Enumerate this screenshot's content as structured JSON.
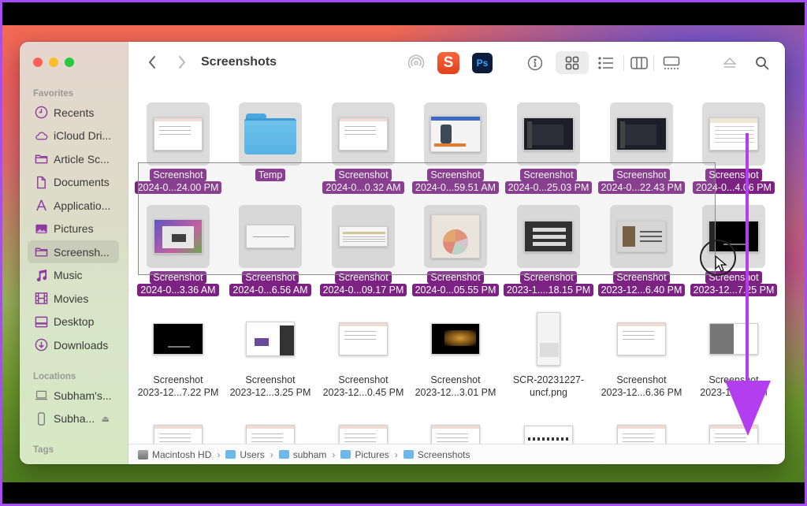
{
  "window": {
    "title": "Screenshots",
    "traffic_lights": [
      "close",
      "minimize",
      "maximize"
    ]
  },
  "sidebar": {
    "favorites_label": "Favorites",
    "favorites": [
      {
        "label": "Recents",
        "icon": "clock-icon"
      },
      {
        "label": "iCloud Dri...",
        "icon": "cloud-icon"
      },
      {
        "label": "Article Sc...",
        "icon": "folder-icon"
      },
      {
        "label": "Documents",
        "icon": "document-icon"
      },
      {
        "label": "Applicatio...",
        "icon": "applications-icon"
      },
      {
        "label": "Pictures",
        "icon": "pictures-icon"
      },
      {
        "label": "Screensh...",
        "icon": "folder-icon",
        "active": true
      },
      {
        "label": "Music",
        "icon": "music-icon"
      },
      {
        "label": "Movies",
        "icon": "film-icon"
      },
      {
        "label": "Desktop",
        "icon": "desktop-icon"
      },
      {
        "label": "Downloads",
        "icon": "download-icon"
      }
    ],
    "locations_label": "Locations",
    "locations": [
      {
        "label": "Subham's...",
        "icon": "laptop-icon"
      },
      {
        "label": "Subha...",
        "icon": "phone-icon",
        "eject": true
      }
    ],
    "tags_label": "Tags"
  },
  "toolbar": {
    "back": "back-icon",
    "forward": "forward-icon",
    "airdrop": "airdrop-icon",
    "apps": [
      "S",
      "Ps"
    ],
    "view_modes": [
      "icon",
      "list",
      "column",
      "gallery"
    ],
    "active_view": "icon"
  },
  "files": [
    {
      "line1": "Screenshot",
      "line2": "2024-0...24.00 PM",
      "selected": true,
      "kind": "light"
    },
    {
      "line1": "Temp",
      "line2": "",
      "selected": true,
      "kind": "folder"
    },
    {
      "line1": "Screenshot",
      "line2": "2024-0...0.32 AM",
      "selected": true,
      "kind": "light"
    },
    {
      "line1": "Screenshot",
      "line2": "2024-0...59.51 AM",
      "selected": true,
      "kind": "product"
    },
    {
      "line1": "Screenshot",
      "line2": "2024-0...25.03 PM",
      "selected": true,
      "kind": "dark"
    },
    {
      "line1": "Screenshot",
      "line2": "2024-0...22.43 PM",
      "selected": true,
      "kind": "dark"
    },
    {
      "line1": "Screenshot",
      "line2": "2024-0...4.06 PM",
      "selected": true,
      "kind": "sheet"
    },
    {
      "line1": "Screenshot",
      "line2": "2024-0...3.36 AM",
      "selected": true,
      "kind": "desktop"
    },
    {
      "line1": "Screenshot",
      "line2": "2024-0...6.56 AM",
      "selected": true,
      "kind": "diagram"
    },
    {
      "line1": "Screenshot",
      "line2": "2024-0...09.17 PM",
      "selected": true,
      "kind": "text"
    },
    {
      "line1": "Screenshot",
      "line2": "2024-0...05.55 PM",
      "selected": true,
      "kind": "pie"
    },
    {
      "line1": "Screenshot",
      "line2": "2023-1....18.15 PM",
      "selected": true,
      "kind": "slide"
    },
    {
      "line1": "Screenshot",
      "line2": "2023-12...6.40 PM",
      "selected": true,
      "kind": "portrait"
    },
    {
      "line1": "Screenshot",
      "line2": "2023-12...7.25 PM",
      "selected": true,
      "kind": "black"
    },
    {
      "line1": "Screenshot",
      "line2": "2023-12...7.22 PM",
      "selected": false,
      "kind": "black"
    },
    {
      "line1": "Screenshot",
      "line2": "2023-12...3.25 PM",
      "selected": false,
      "kind": "web"
    },
    {
      "line1": "Screenshot",
      "line2": "2023-12...0.45 PM",
      "selected": false,
      "kind": "light"
    },
    {
      "line1": "Screenshot",
      "line2": "2023-12...3.01 PM",
      "selected": false,
      "kind": "night"
    },
    {
      "line1": "SCR-20231227-",
      "line2": "uncf.png",
      "selected": false,
      "kind": "phone"
    },
    {
      "line1": "Screenshot",
      "line2": "2023-12...6.36 PM",
      "selected": false,
      "kind": "light"
    },
    {
      "line1": "Screenshot",
      "line2": "2023-12...4 PM",
      "selected": false,
      "kind": "gray"
    },
    {
      "line1": "",
      "line2": "",
      "selected": false,
      "kind": "light"
    },
    {
      "line1": "",
      "line2": "",
      "selected": false,
      "kind": "light"
    },
    {
      "line1": "",
      "line2": "",
      "selected": false,
      "kind": "light"
    },
    {
      "line1": "",
      "line2": "",
      "selected": false,
      "kind": "light"
    },
    {
      "line1": "",
      "line2": "",
      "selected": false,
      "kind": "keyboard"
    },
    {
      "line1": "",
      "line2": "",
      "selected": false,
      "kind": "light"
    },
    {
      "line1": "",
      "line2": "",
      "selected": false,
      "kind": "light"
    }
  ],
  "pathbar": [
    {
      "label": "Macintosh HD",
      "icon": "hard-drive-icon"
    },
    {
      "label": "Users",
      "icon": "folder-icon"
    },
    {
      "label": "subham",
      "icon": "home-folder-icon"
    },
    {
      "label": "Pictures",
      "icon": "folder-icon"
    },
    {
      "label": "Screenshots",
      "icon": "folder-icon"
    }
  ],
  "colors": {
    "selection": "#7c2283",
    "annotation_arrow": "#b23ef0",
    "sidebar_icon": "#8e3a9e"
  }
}
